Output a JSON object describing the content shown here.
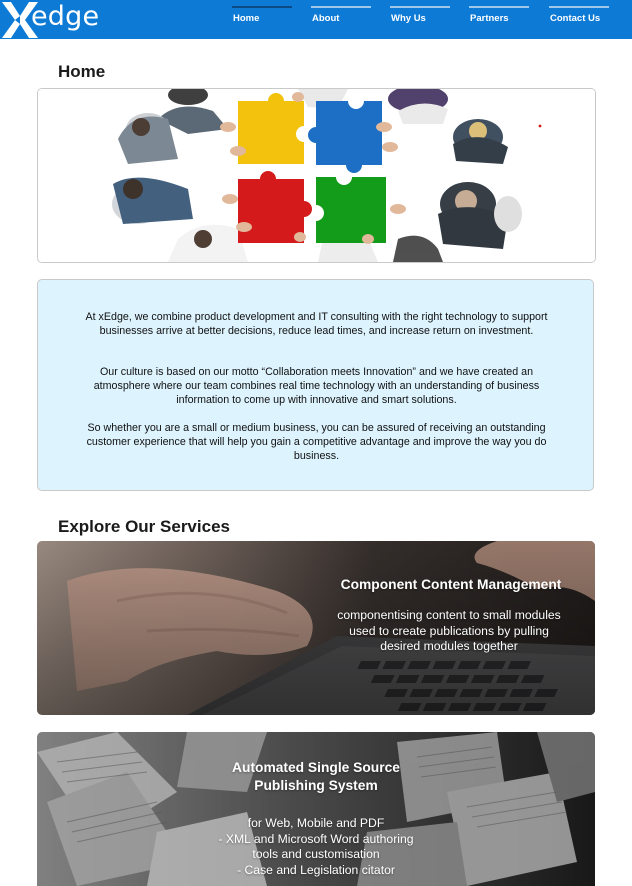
{
  "brand": {
    "logo_text": "edge",
    "colors": {
      "header": "#0d7ad6",
      "intro_bg": "#ddf3fe"
    }
  },
  "nav": [
    {
      "label": "Home",
      "active": true
    },
    {
      "label": "About",
      "active": false
    },
    {
      "label": "Why Us",
      "active": false
    },
    {
      "label": "Partners",
      "active": false
    },
    {
      "label": "Contact Us",
      "active": false
    }
  ],
  "page_title": "Home",
  "hero": {
    "image": "team-puzzle-collaboration-photo"
  },
  "intro": {
    "paragraphs": [
      "At xEdge, we combine product development and IT consulting with the right technology to support businesses arrive at better decisions, reduce lead times, and increase return on investment.",
      "Our culture is based on our motto “Collaboration meets Innovation” and we have created an atmosphere where our team combines real time technology with an understanding of business information to come up with innovative and smart solutions.",
      "So whether you are a small or medium business, you can be assured of receiving an outstanding customer experience that will help you gain a competitive advantage and improve the way you do business."
    ]
  },
  "services": {
    "title": "Explore Our Services",
    "items": [
      {
        "title": "Component Content Management",
        "description": "componentising content to small modules used to create publications by pulling desired modules together",
        "image": "hands-on-laptop-photo"
      },
      {
        "title": "Automated Single Source Publishing System",
        "description_lines": [
          "for Web, Mobile and PDF",
          "- XML and Microsoft Word authoring",
          "tools and customisation",
          "- Case and Legislation citator"
        ],
        "image": "flying-books-photo"
      }
    ]
  }
}
